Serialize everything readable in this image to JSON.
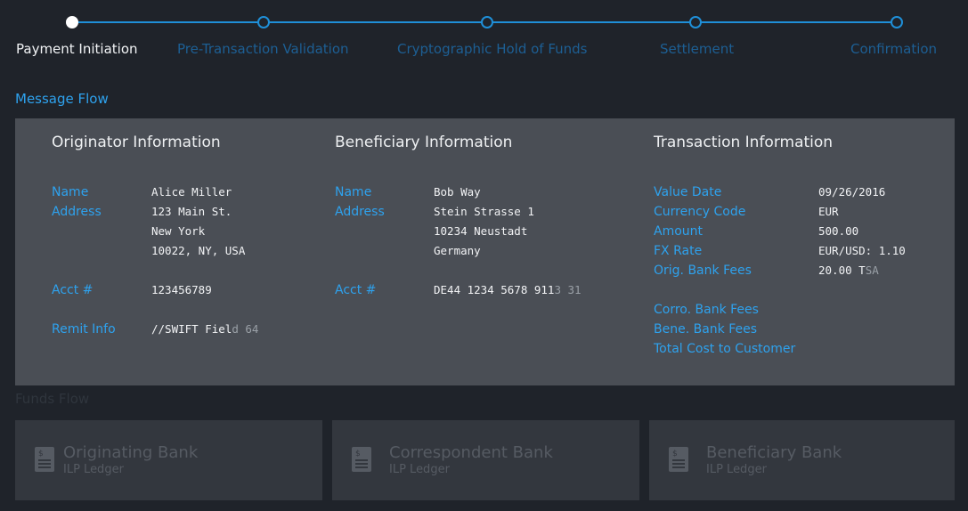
{
  "stepper": {
    "steps": [
      {
        "label": "Payment Initiation",
        "active": true
      },
      {
        "label": "Pre-Transaction Validation",
        "active": false
      },
      {
        "label": "Cryptographic Hold of Funds",
        "active": false
      },
      {
        "label": "Settlement",
        "active": false
      },
      {
        "label": "Confirmation",
        "active": false
      }
    ],
    "active_color": "#ffffff",
    "inactive_color": "#1f8fd8"
  },
  "message_flow": {
    "title": "Message Flow",
    "originator": {
      "title": "Originator Information",
      "name_label": "Name",
      "name": "Alice Miller",
      "address_label": "Address",
      "address_line1": "123 Main St.",
      "address_line2": "New York",
      "address_line3": "10022, NY, USA",
      "acct_label": "Acct #",
      "acct": "123456789",
      "remit_label": "Remit Info",
      "remit_main": "//SWIFT Fiel",
      "remit_faded": "d 64"
    },
    "beneficiary": {
      "title": "Beneficiary Information",
      "name_label": "Name",
      "name": "Bob Way",
      "address_label": "Address",
      "address_line1": "Stein Strasse 1",
      "address_line2": "10234 Neustadt",
      "address_line3": "Germany",
      "acct_label": "Acct #",
      "acct_main": "DE44 1234 5678 911",
      "acct_faded": "3 31"
    },
    "transaction": {
      "title": "Transaction Information",
      "value_date_label": "Value Date",
      "value_date": "09/26/2016",
      "currency_label": "Currency Code",
      "currency": "EUR",
      "amount_label": "Amount",
      "amount": "500.00",
      "fx_label": "FX Rate",
      "fx": "EUR/USD: 1.10",
      "orig_fees_label": "Orig. Bank Fees",
      "orig_fees_main": "20.00 T",
      "orig_fees_faded": "SA",
      "corro_fees_label": "Corro. Bank Fees",
      "bene_fees_label": "Bene. Bank Fees",
      "total_cost_label": "Total Cost to Customer"
    }
  },
  "funds_flow": {
    "title": "Funds Flow",
    "banks": [
      {
        "name": "Originating Bank",
        "sub": "ILP Ledger",
        "icon": "ledger-icon"
      },
      {
        "name": "Correspondent Bank",
        "sub": "ILP Ledger",
        "icon": "ledger-icon"
      },
      {
        "name": "Beneficiary Bank",
        "sub": "ILP Ledger",
        "icon": "ledger-icon"
      }
    ]
  }
}
